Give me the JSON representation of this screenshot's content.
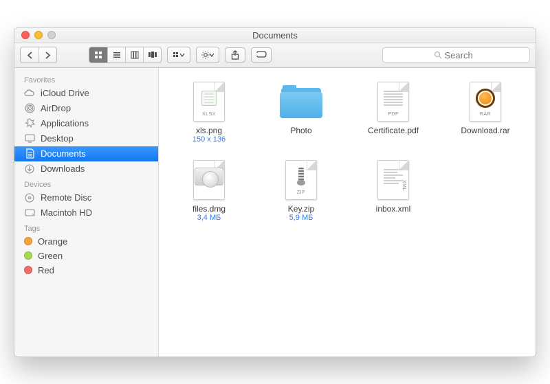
{
  "window": {
    "title": "Documents"
  },
  "search": {
    "placeholder": "Search"
  },
  "sidebar": {
    "sections": [
      {
        "title": "Favorites",
        "items": [
          {
            "label": "iCloud Drive",
            "icon": "cloud"
          },
          {
            "label": "AirDrop",
            "icon": "airdrop"
          },
          {
            "label": "Applications",
            "icon": "apps"
          },
          {
            "label": "Desktop",
            "icon": "desktop"
          },
          {
            "label": "Documents",
            "icon": "documents",
            "active": true
          },
          {
            "label": "Downloads",
            "icon": "downloads"
          }
        ]
      },
      {
        "title": "Devices",
        "items": [
          {
            "label": "Remote Disc",
            "icon": "disc"
          },
          {
            "label": "Macintoh HD",
            "icon": "hd"
          }
        ]
      },
      {
        "title": "Tags",
        "items": [
          {
            "label": "Orange",
            "color": "#f7a13b"
          },
          {
            "label": "Green",
            "color": "#a6d94f"
          },
          {
            "label": "Red",
            "color": "#f46a6a"
          }
        ]
      }
    ]
  },
  "files": [
    {
      "name": "xls.png",
      "meta": "150 x 136",
      "type": "image",
      "badge": "XLSX"
    },
    {
      "name": "Photo",
      "type": "folder"
    },
    {
      "name": "Certificate.pdf",
      "type": "pdf",
      "badge": "PDF"
    },
    {
      "name": "Download.rar",
      "type": "rar",
      "badge": "RAR"
    },
    {
      "name": "files.dmg",
      "meta": "3,4 МБ",
      "type": "dmg"
    },
    {
      "name": "Key.zip",
      "meta": "5,9 МБ",
      "type": "zip",
      "badge": "ZIP"
    },
    {
      "name": "inbox.xml",
      "type": "xml",
      "badge": "XML"
    }
  ]
}
